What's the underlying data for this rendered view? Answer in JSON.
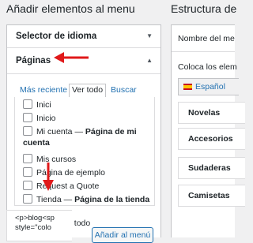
{
  "left_panel": {
    "title": "Añadir elementos al menu",
    "sections": {
      "language_selector": "Selector de idioma",
      "pages": "Páginas"
    },
    "tabs": [
      "Más reciente",
      "Ver todo",
      "Buscar"
    ],
    "active_tab": "Ver todo",
    "items": [
      {
        "label": "Inici",
        "suffix": ""
      },
      {
        "label": "Inicio",
        "suffix": ""
      },
      {
        "label": "Mi cuenta — ",
        "suffix": "Página de mi"
      },
      {
        "label": "",
        "suffix": "cuenta"
      },
      {
        "label": "Mis cursos",
        "suffix": ""
      },
      {
        "label": "Página de ejemplo",
        "suffix": ""
      },
      {
        "label": "Request a Quote",
        "suffix": ""
      },
      {
        "label": "Tienda — ",
        "suffix": "Página de la tienda"
      }
    ],
    "select_all": "Seleccionar todo",
    "add_button": "Añadir al menú"
  },
  "right_panel": {
    "title": "Estructura de",
    "menu_name_label": "Nombre del me",
    "description": "Coloca los elem",
    "language_button": "Español",
    "menu_items": [
      "Novelas",
      "Accesorios",
      "Sudaderas",
      "Camisetas"
    ],
    "code_line1": "<p>blog<sp",
    "code_line2": "style=\"colo"
  },
  "colors": {
    "accent": "#2271b1",
    "annotation_arrow": "#e0191a"
  },
  "icons": {
    "collapsed_toggle": "chevron-down-icon",
    "expanded_toggle": "chevron-up-icon"
  }
}
